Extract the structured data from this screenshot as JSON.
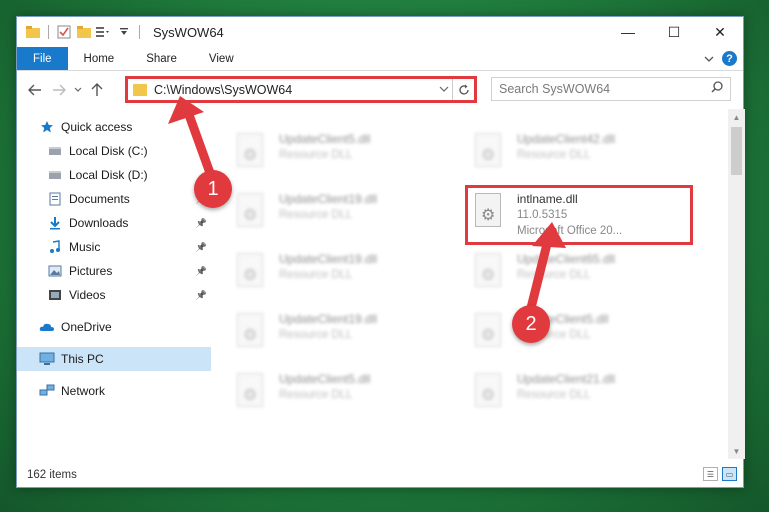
{
  "window": {
    "title": "SysWOW64",
    "controls": {
      "minimize": "—",
      "maximize": "☐",
      "close": "✕"
    }
  },
  "ribbon": {
    "tabs": [
      "File",
      "Home",
      "Share",
      "View"
    ],
    "help": "?"
  },
  "address": {
    "path": "C:\\Windows\\SysWOW64"
  },
  "search": {
    "placeholder": "Search SysWOW64"
  },
  "nav": {
    "items": [
      {
        "label": "Quick access",
        "icon": "star-icon"
      },
      {
        "label": "Local Disk (C:)",
        "icon": "drive-icon",
        "pinned": true
      },
      {
        "label": "Local Disk (D:)",
        "icon": "drive-icon",
        "pinned": true
      },
      {
        "label": "Documents",
        "icon": "documents-icon",
        "pinned": true
      },
      {
        "label": "Downloads",
        "icon": "downloads-icon",
        "pinned": true
      },
      {
        "label": "Music",
        "icon": "music-icon",
        "pinned": true
      },
      {
        "label": "Pictures",
        "icon": "pictures-icon",
        "pinned": true
      },
      {
        "label": "Videos",
        "icon": "videos-icon",
        "pinned": true
      },
      {
        "label": "OneDrive",
        "icon": "onedrive-icon"
      },
      {
        "label": "This PC",
        "icon": "pc-icon",
        "selected": true
      },
      {
        "label": "Network",
        "icon": "network-icon"
      }
    ]
  },
  "files": [
    {
      "name": "UpdateClient5.dll",
      "desc": "Resource DLL"
    },
    {
      "name": "UpdateClient42.dll",
      "desc": "Resource DLL"
    },
    {
      "name": "UpdateClient19.dll",
      "desc": "Resource DLL"
    },
    {
      "name": "intlname.dll",
      "version": "11.0.5315",
      "desc": "Microsoft Office 20..."
    },
    {
      "name": "UpdateClient19.dll",
      "desc": "Resource DLL"
    },
    {
      "name": "UpdateClient65.dll",
      "desc": "Resource DLL"
    },
    {
      "name": "UpdateClient19.dll",
      "desc": "Resource DLL"
    },
    {
      "name": "UpdateClient5.dll",
      "desc": "Resource DLL"
    },
    {
      "name": "UpdateClient5.dll",
      "desc": "Resource DLL"
    },
    {
      "name": "UpdateClient21.dll",
      "desc": "Resource DLL"
    }
  ],
  "status": {
    "count": "162 items"
  },
  "callouts": [
    "1",
    "2"
  ],
  "colors": {
    "accent": "#1979ca",
    "highlight": "#e0393e",
    "selected": "#cce4f7"
  }
}
